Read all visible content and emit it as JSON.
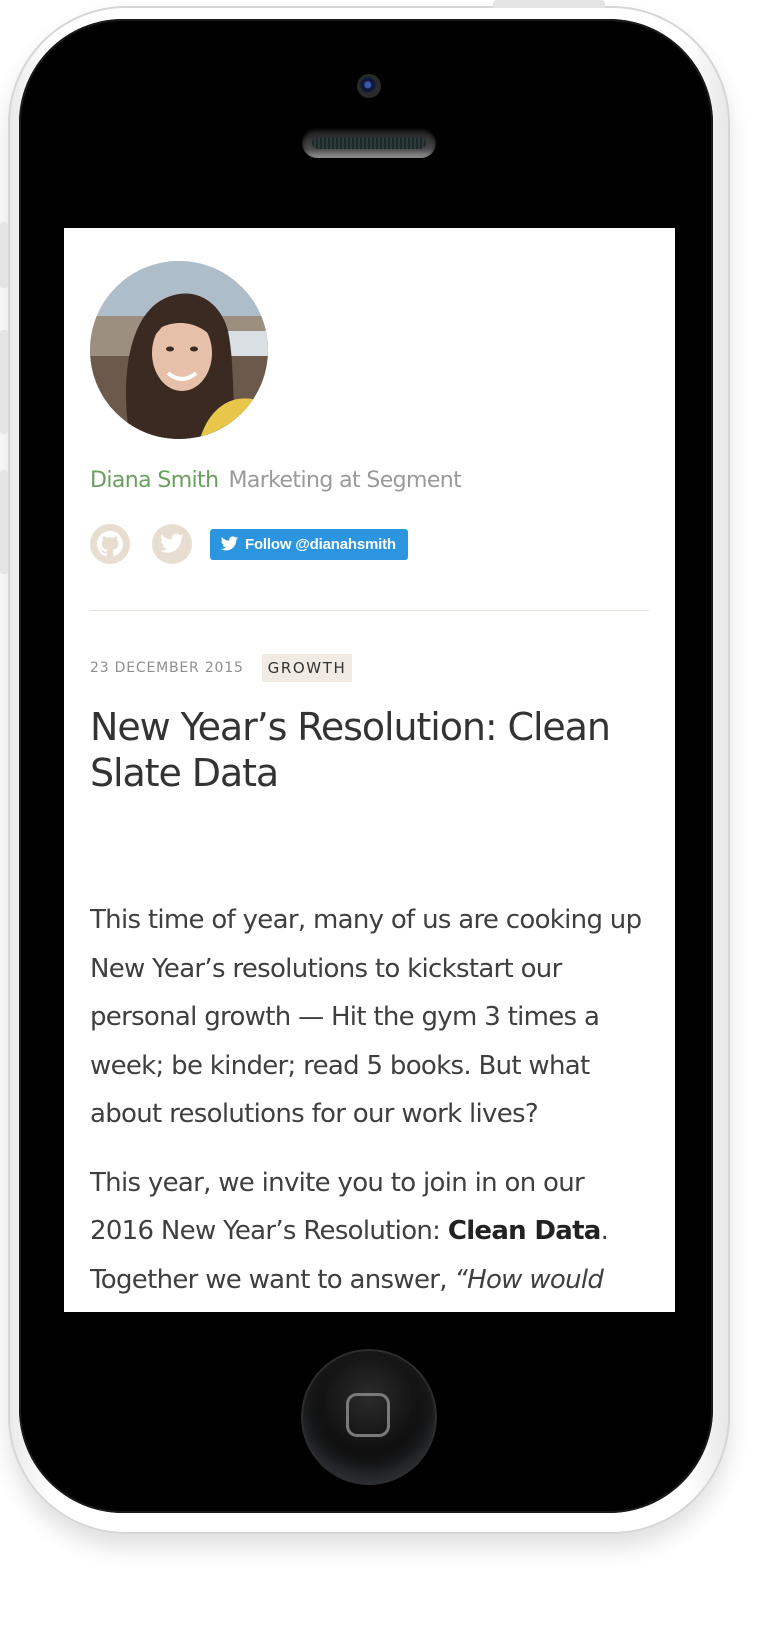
{
  "author": {
    "name": "Diana Smith",
    "role": "Marketing at Segment"
  },
  "social": {
    "github_icon": "github-icon",
    "twitter_icon": "twitter-icon",
    "follow_label": "Follow @dianahsmith",
    "follow_color": "#2b95e0"
  },
  "post": {
    "date": "23 DECEMBER 2015",
    "tag": "GROWTH",
    "title": "New Year’s Resolution: Clean Slate Data",
    "paragraphs": [
      {
        "text": "This time of year, many of us are cooking up New Year’s resolutions to kickstart our personal growth — Hit the gym 3 times a week; be kinder; read 5 books. But what about resolutions for our work lives?"
      },
      {
        "before": "This year, we invite you to join in on our 2016 New Year’s Resolution: ",
        "bold": "Clean Data",
        "after": ". Together we want to answer, ",
        "italic": "“How would"
      }
    ]
  },
  "colors": {
    "author_name": "#6aa05f",
    "author_role": "#9a9a9a",
    "icon_bg": "#e7ddd1",
    "tag_bg": "#f1ebe4"
  }
}
